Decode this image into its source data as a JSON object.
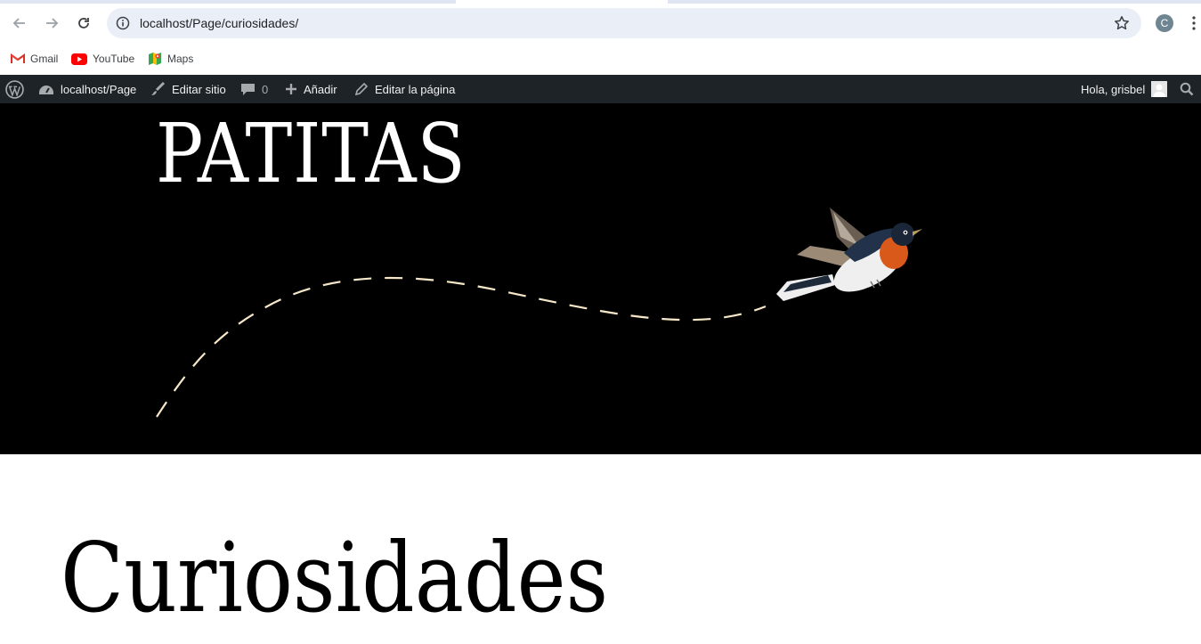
{
  "browser": {
    "url": "localhost/Page/curiosidades/",
    "profile_initial": "C"
  },
  "bookmarks": [
    {
      "label": "Gmail",
      "icon": "gmail-icon"
    },
    {
      "label": "YouTube",
      "icon": "youtube-icon"
    },
    {
      "label": "Maps",
      "icon": "maps-icon"
    }
  ],
  "adminbar": {
    "site_name": "localhost/Page",
    "edit_site": "Editar sitio",
    "comments_count": "0",
    "add_new": "Añadir",
    "edit_page": "Editar la página",
    "greeting": "Hola, grisbel"
  },
  "site": {
    "title": "PATITAS"
  },
  "page": {
    "title": "Curiosidades"
  },
  "colors": {
    "adminbar_bg": "#1d2327",
    "hero_bg": "#000000",
    "dash_color": "#f6e7c9"
  }
}
